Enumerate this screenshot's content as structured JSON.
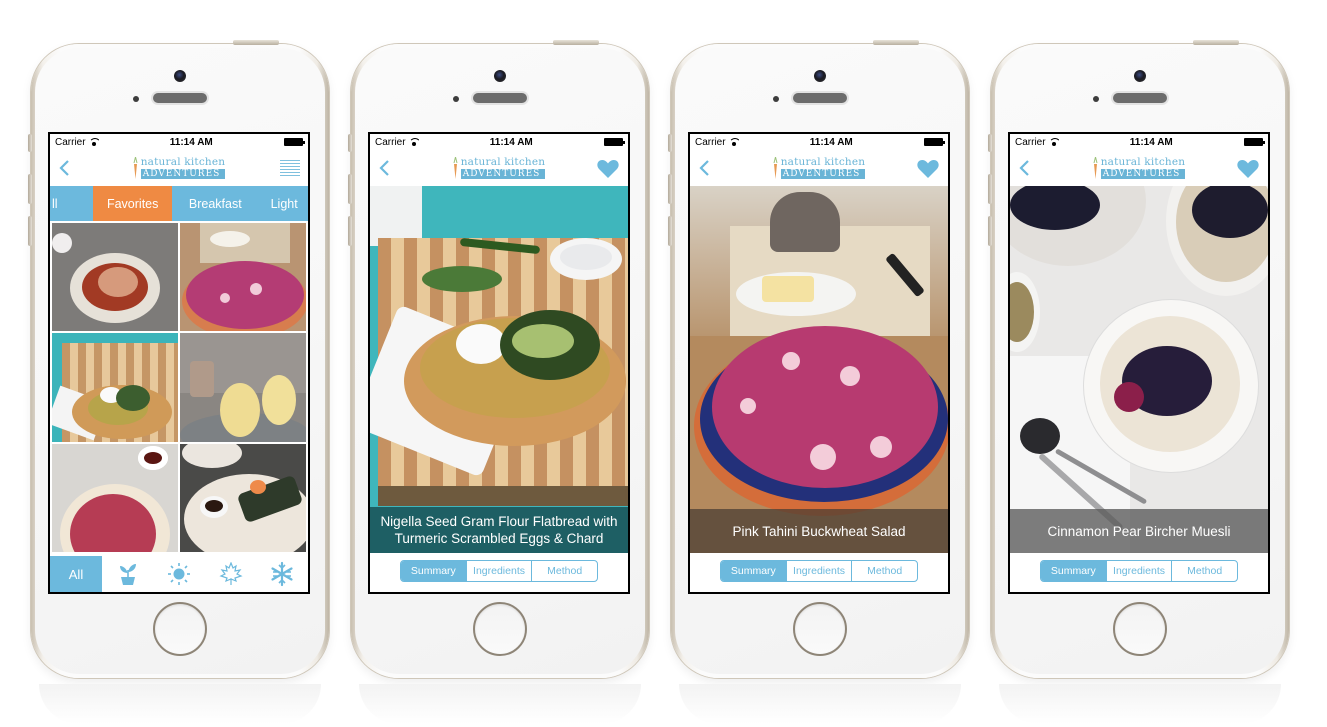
{
  "status_bar": {
    "carrier": "Carrier",
    "time": "11:14 AM"
  },
  "brand": {
    "logo_top": "natural kitchen",
    "logo_bottom": "ADVENTURES",
    "accent": "#6cb9dd",
    "highlight": "#ef8a43"
  },
  "phones": [
    {
      "screen": "recipe-list",
      "categories": [
        {
          "label": "ll",
          "active": false
        },
        {
          "label": "Favorites",
          "active": true
        },
        {
          "label": "Breakfast",
          "active": false
        },
        {
          "label": "Light",
          "active": false
        }
      ],
      "tiles": [
        {
          "name": "salmon-stew-bowl"
        },
        {
          "name": "pink-buckwheat-salad"
        },
        {
          "name": "gram-flour-flatbread"
        },
        {
          "name": "poached-pears"
        },
        {
          "name": "beetroot-hummus"
        },
        {
          "name": "nori-rolls"
        }
      ],
      "bottom_tabs": [
        {
          "label": "All",
          "icon": "all",
          "active": true
        },
        {
          "label": "",
          "icon": "sprout-icon",
          "active": false
        },
        {
          "label": "",
          "icon": "sun-icon",
          "active": false
        },
        {
          "label": "",
          "icon": "maple-leaf-icon",
          "active": false
        },
        {
          "label": "",
          "icon": "snowflake-icon",
          "active": false
        }
      ]
    },
    {
      "screen": "recipe-detail",
      "title_line1": "Nigella Seed Gram Flour Flatbread with",
      "title_line2": "Turmeric Scrambled Eggs & Chard",
      "segments": [
        {
          "label": "Summary",
          "active": true
        },
        {
          "label": "Ingredients",
          "active": false
        },
        {
          "label": "Method",
          "active": false
        }
      ]
    },
    {
      "screen": "recipe-detail",
      "title_line1": "Pink Tahini Buckwheat Salad",
      "title_line2": "",
      "segments": [
        {
          "label": "Summary",
          "active": true
        },
        {
          "label": "Ingredients",
          "active": false
        },
        {
          "label": "Method",
          "active": false
        }
      ]
    },
    {
      "screen": "recipe-detail",
      "title_line1": "Cinnamon Pear Bircher Muesli",
      "title_line2": "",
      "segments": [
        {
          "label": "Summary",
          "active": true
        },
        {
          "label": "Ingredients",
          "active": false
        },
        {
          "label": "Method",
          "active": false
        }
      ]
    }
  ]
}
